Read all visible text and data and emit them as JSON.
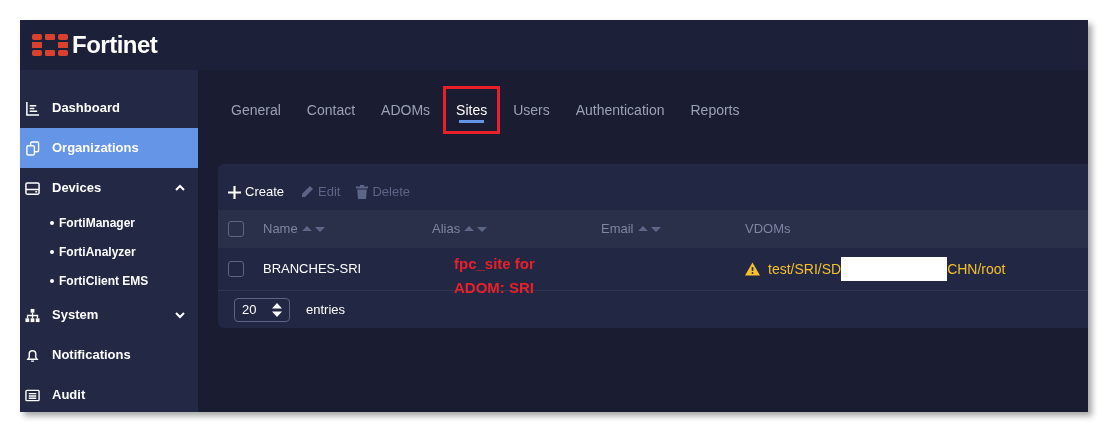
{
  "brand": "Fortinet",
  "sidebar": {
    "items": [
      {
        "label": "Dashboard",
        "selected": false
      },
      {
        "label": "Organizations",
        "selected": true
      },
      {
        "label": "Devices",
        "selected": false,
        "expanded": true,
        "children": [
          {
            "label": "FortiManager"
          },
          {
            "label": "FortiAnalyzer"
          },
          {
            "label": "FortiClient EMS"
          }
        ]
      },
      {
        "label": "System",
        "selected": false,
        "expanded": false
      },
      {
        "label": "Notifications",
        "selected": false
      },
      {
        "label": "Audit",
        "selected": false
      }
    ]
  },
  "tabs": [
    {
      "label": "General",
      "selected": false,
      "highlighted": false
    },
    {
      "label": "Contact",
      "selected": false,
      "highlighted": false
    },
    {
      "label": "ADOMs",
      "selected": false,
      "highlighted": false
    },
    {
      "label": "Sites",
      "selected": true,
      "highlighted": true
    },
    {
      "label": "Users",
      "selected": false,
      "highlighted": false
    },
    {
      "label": "Authentication",
      "selected": false,
      "highlighted": false
    },
    {
      "label": "Reports",
      "selected": false,
      "highlighted": false
    }
  ],
  "toolbar": [
    {
      "label": "Create",
      "disabled": false
    },
    {
      "label": "Edit",
      "disabled": true
    },
    {
      "label": "Delete",
      "disabled": true
    }
  ],
  "table": {
    "header_checked": false,
    "columns": [
      {
        "label": "Name",
        "sortable": true
      },
      {
        "label": "Alias",
        "sortable": true
      },
      {
        "label": "Email",
        "sortable": true
      },
      {
        "label": "VDOMs",
        "sortable": false
      }
    ],
    "rows": [
      {
        "checked": false,
        "name": "BRANCHES-SRI",
        "vdom_warning": true,
        "vdom_start": "test/SRI/SD",
        "vdom_end": "CHN/root"
      }
    ]
  },
  "page_size": "20",
  "page_size_label": "entries",
  "annotation": [
    "fpc_site for",
    "ADOM: SRI"
  ]
}
